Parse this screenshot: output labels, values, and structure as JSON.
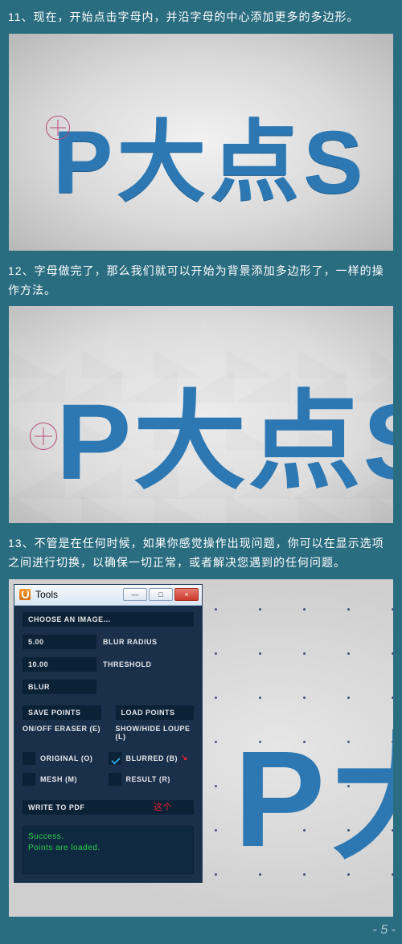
{
  "steps": {
    "s11": "11、现在，开始点击字母内，并沿字母的中心添加更多的多边形。",
    "s12": "12、字母做完了，那么我们就可以开始为背景添加多边形了，一样的操作方法。",
    "s13": "13、不管是在任何时候，如果你感觉操作出现问题，你可以在显示选项之间进行切换，以确保一切正常，或者解决您遇到的任何问题。"
  },
  "logo_text": "P大点S",
  "tools": {
    "title": "Tools",
    "choose_image": "CHOOSE AN IMAGE...",
    "blur_radius_value": "5.00",
    "blur_radius_label": "BLUR RADIUS",
    "threshold_value": "10.00",
    "threshold_label": "THRESHOLD",
    "blur_btn": "BLUR",
    "save_points": "SAVE POINTS",
    "load_points": "LOAD POINTS",
    "eraser_label": "ON/OFF ERASER (E)",
    "loupe_label": "SHOW/HIDE LOUPE (L)",
    "original": "ORIGINAL (O)",
    "blurred": "BLURRED (B)",
    "mesh": "MESH (M)",
    "result": "RESULT (R)",
    "annot": "这个",
    "write_pdf": "WRITE TO PDF",
    "status1": "Success.",
    "status2": "Points are loaded.",
    "win_min": "—",
    "win_max": "□",
    "win_close": "×"
  },
  "page_number": "- 5 -",
  "chart_data": null
}
